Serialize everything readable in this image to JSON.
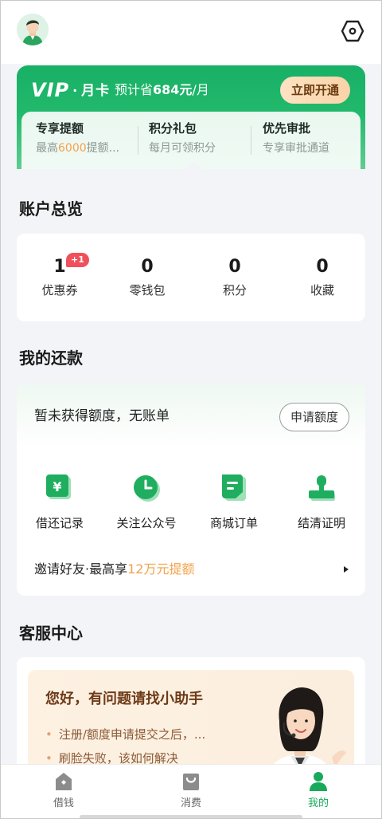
{
  "header": {
    "avatar_icon": "user-avatar",
    "settings_icon": "hexagon-settings-icon"
  },
  "vip": {
    "logo_text": "VIP",
    "dot": "·",
    "month_label": "月卡",
    "save_prefix": "预计省",
    "save_amount": "684元",
    "save_suffix": "/月",
    "open_button": "立即开通",
    "perks": [
      {
        "title": "专享提额",
        "sub_prefix": "最高",
        "sub_highlight": "6000",
        "sub_suffix": "提额..."
      },
      {
        "title": "积分礼包",
        "sub": "每月可领积分"
      },
      {
        "title": "优先审批",
        "sub": "专享审批通道"
      }
    ]
  },
  "overview": {
    "title": "账户总览",
    "stats": [
      {
        "value": "1",
        "label": "优惠券",
        "badge": "+1"
      },
      {
        "value": "0",
        "label": "零钱包"
      },
      {
        "value": "0",
        "label": "积分"
      },
      {
        "value": "0",
        "label": "收藏"
      }
    ]
  },
  "repayment": {
    "title": "我的还款",
    "no_bill_text": "暂未获得额度，无账单",
    "apply_button": "申请额度",
    "quick_actions": [
      {
        "label": "借还记录",
        "icon": "yuan-receipt-icon"
      },
      {
        "label": "关注公众号",
        "icon": "clock-icon"
      },
      {
        "label": "商城订单",
        "icon": "document-icon"
      },
      {
        "label": "结清证明",
        "icon": "stamp-icon"
      }
    ],
    "invite_prefix": "邀请好友·最高享",
    "invite_highlight": "12万元提额"
  },
  "service": {
    "title": "客服中心",
    "banner_title": "您好，有问题请找小助手",
    "faqs": [
      "注册/额度申请提交之后，...",
      "刷脸失败，该如何解决"
    ]
  },
  "tabbar": {
    "tabs": [
      {
        "label": "借钱",
        "icon": "home-icon",
        "active": false
      },
      {
        "label": "消费",
        "icon": "shopping-bag-icon",
        "active": false
      },
      {
        "label": "我的",
        "icon": "person-icon",
        "active": true
      }
    ]
  },
  "colors": {
    "brand_green": "#19a95d",
    "highlight_orange": "#f3a24a",
    "badge_red": "#f0505a"
  }
}
